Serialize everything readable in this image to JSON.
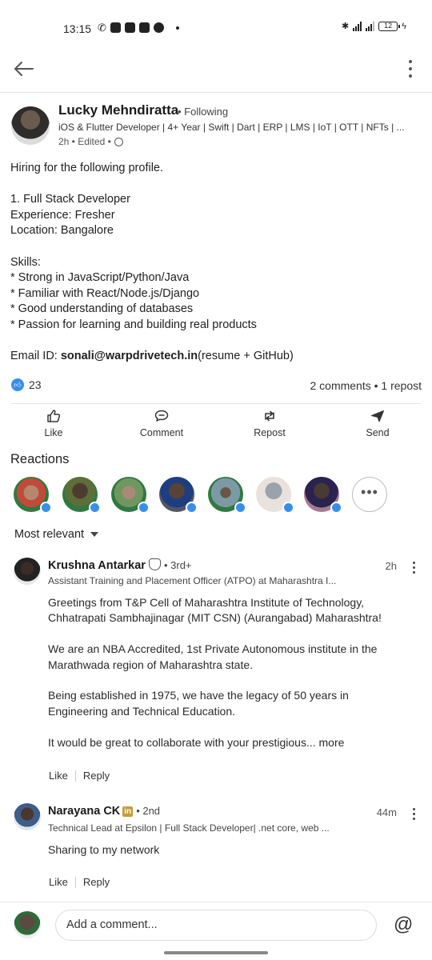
{
  "status_bar": {
    "time": "13:15",
    "battery": "12"
  },
  "post": {
    "author": {
      "name": "Lucky Mehndiratta",
      "follow_status": "• Following",
      "headline": "iOS & Flutter Developer | 4+ Year | Swift | Dart | ERP | LMS | IoT | OTT | NFTs | ...",
      "meta": "2h • Edited •"
    },
    "body": {
      "line1": "Hiring for the following profile.",
      "line2": "",
      "line3": "1. Full Stack Developer",
      "line4": "Experience: Fresher",
      "line5": "Location: Bangalore",
      "line6": "",
      "line7": "Skills:",
      "line8": "* Strong in JavaScript/Python/Java",
      "line9": "* Familiar with React/Node.js/Django",
      "line10": "* Good understanding of databases",
      "line11": "* Passion for learning and building real products",
      "line12": "",
      "email_prefix": "Email ID: ",
      "email": "sonali@warpdrivetech.in",
      "email_suffix": "(resume + GitHub)"
    },
    "likes_count": "23",
    "comments_reposts": "2 comments • 1 repost"
  },
  "actions": {
    "like": "Like",
    "comment": "Comment",
    "repost": "Repost",
    "send": "Send"
  },
  "reactions": {
    "title": "Reactions",
    "more": "•••"
  },
  "sort": {
    "label": "Most relevant"
  },
  "comments": [
    {
      "name": "Krushna Antarkar",
      "degree": "• 3rd+",
      "headline": "Assistant Training and Placement Officer (ATPO) at Maharashtra I...",
      "time": "2h",
      "body": [
        "Greetings from T&P Cell of Maharashtra Institute of Technology,",
        "Chhatrapati Sambhajinagar (MIT CSN) (Aurangabad) Maharashtra!",
        "",
        "We are an NBA Accredited, 1st Private Autonomous institute in the",
        "Marathwada region of Maharashtra state.",
        "",
        "Being established in 1975, we have the legacy of 50 years in",
        "Engineering and Technical Education.",
        "",
        "It would be great to collaborate with your prestigious... more"
      ],
      "like": "Like",
      "reply": "Reply"
    },
    {
      "name": "Narayana CK",
      "badge": "in",
      "degree": "• 2nd",
      "headline": "Technical Lead at Epsilon | Full Stack Developer| .net core, web ...",
      "time": "44m",
      "body": [
        "Sharing to my network"
      ],
      "like": "Like",
      "reply": "Reply"
    }
  ],
  "composer": {
    "placeholder": "Add a comment..."
  },
  "colors": {
    "accent": "#378fe9",
    "text": "#1f1f1f",
    "divider": "#e6e6e6"
  }
}
